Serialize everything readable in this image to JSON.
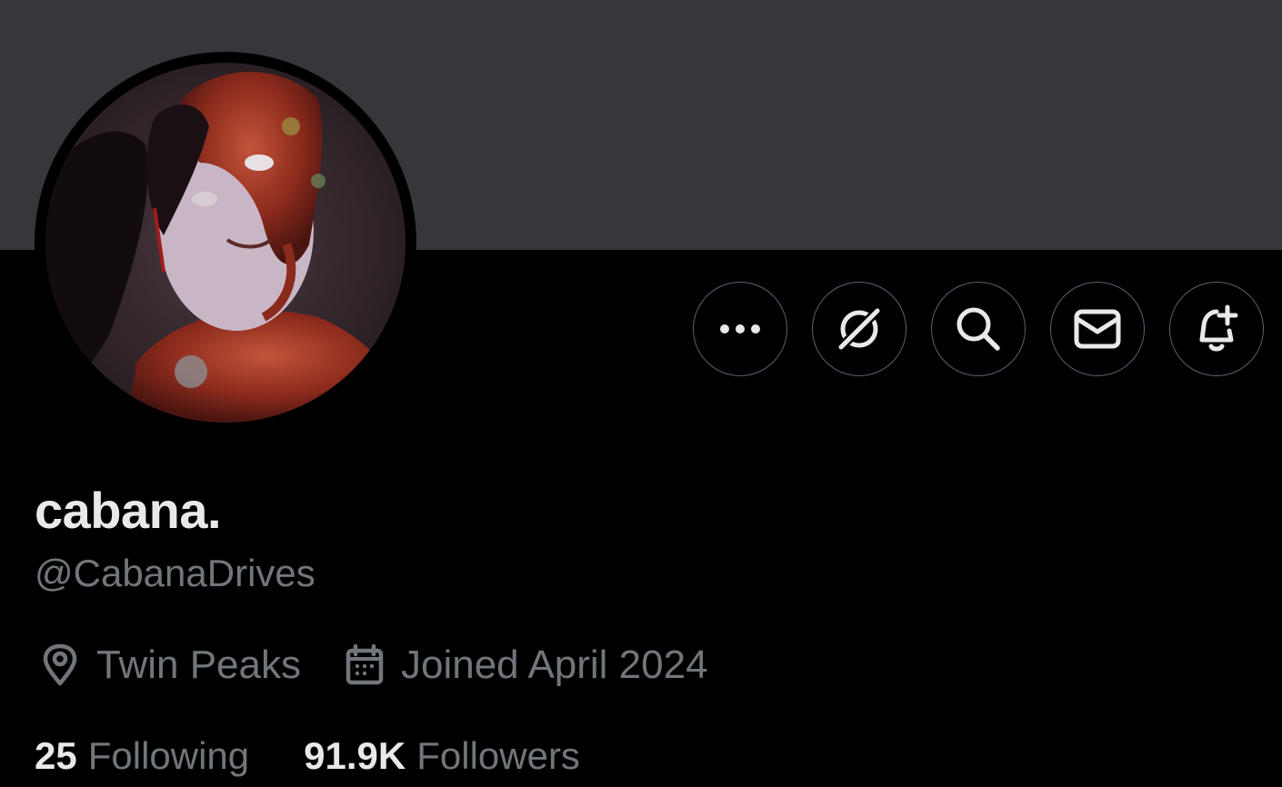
{
  "profile": {
    "display_name": "cabana.",
    "handle": "@CabanaDrives",
    "location": "Twin Peaks",
    "joined": "Joined April 2024",
    "avatar_icon": "profile-photo"
  },
  "actions": [
    {
      "name": "more-options-button",
      "icon": "ellipsis-icon"
    },
    {
      "name": "grok-button",
      "icon": "grok-icon"
    },
    {
      "name": "search-button",
      "icon": "search-icon"
    },
    {
      "name": "message-button",
      "icon": "envelope-icon"
    },
    {
      "name": "notify-button",
      "icon": "bell-plus-icon"
    }
  ],
  "stats": {
    "following_count": "25",
    "following_label": "Following",
    "followers_count": "91.9K",
    "followers_label": "Followers"
  },
  "colors": {
    "background": "#000000",
    "banner": "#36373b",
    "primary_text": "#e7e9ea",
    "secondary_text": "#71767b",
    "button_border": "#536471"
  }
}
